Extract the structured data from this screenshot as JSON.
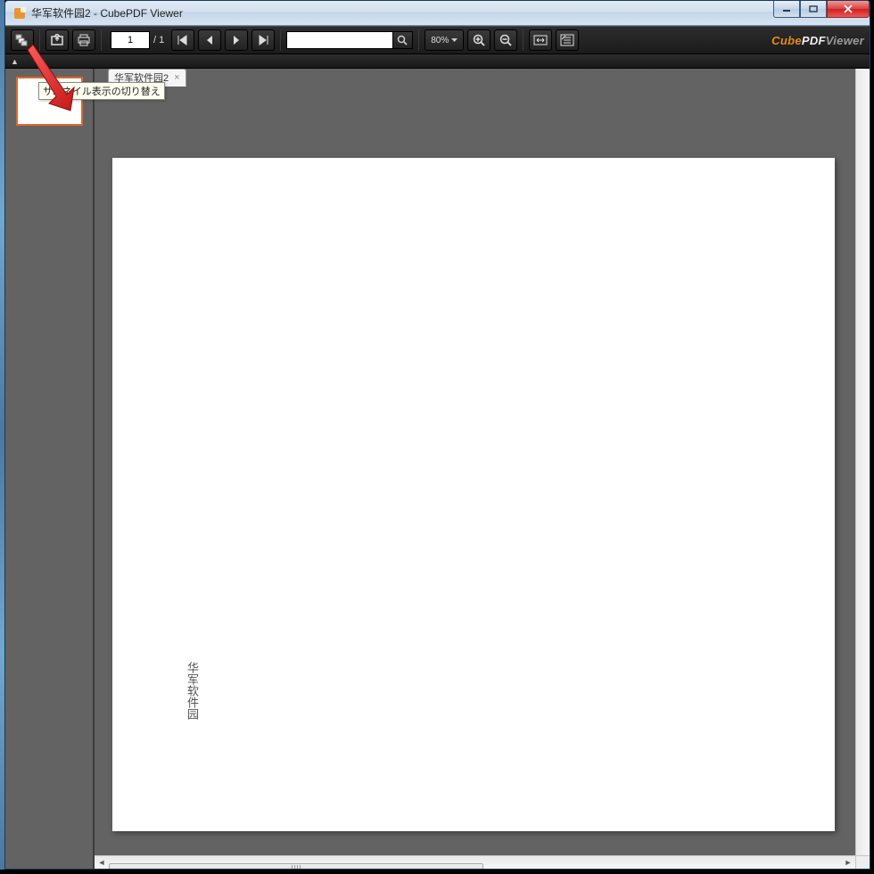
{
  "window": {
    "title": "华军软件园2 - CubePDF Viewer"
  },
  "toolbar": {
    "page_current": "1",
    "page_total": "/ 1",
    "zoom_label": "80%",
    "search_placeholder": ""
  },
  "tab": {
    "title": "华军软件园2"
  },
  "tooltip": {
    "text": "サムネイル表示の切り替え"
  },
  "page": {
    "text": "华军软件园"
  },
  "brand": {
    "p1": "Cube",
    "p2": "PDF",
    "p3": "Viewer"
  },
  "icons": {
    "thumbnail_toggle": "thumbnail-toggle-icon",
    "open": "open-file-icon",
    "print": "print-icon",
    "first": "first-page-icon",
    "prev": "prev-page-icon",
    "next": "next-page-icon",
    "last": "last-page-icon",
    "search": "search-icon",
    "zoom_in": "zoom-in-icon",
    "zoom_out": "zoom-out-icon",
    "fit_w": "fit-width-icon",
    "fit_p": "fit-page-icon",
    "minimize": "minimize-icon",
    "maximize": "maximize-icon",
    "close": "close-icon"
  }
}
